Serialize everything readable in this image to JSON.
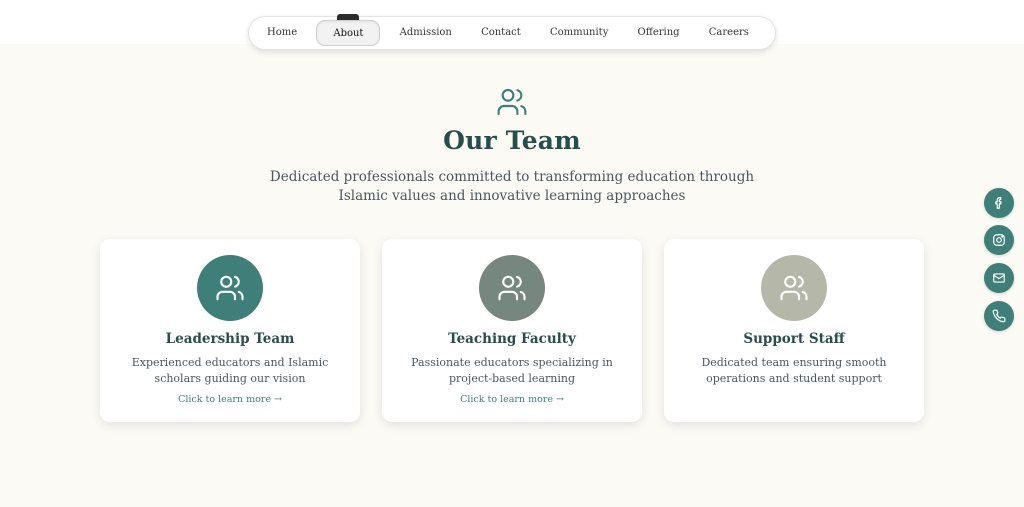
{
  "nav": {
    "items": [
      {
        "label": "Home"
      },
      {
        "label": "About",
        "active": true
      },
      {
        "label": "Admission"
      },
      {
        "label": "Contact"
      },
      {
        "label": "Community"
      },
      {
        "label": "Offering"
      },
      {
        "label": "Careers"
      }
    ]
  },
  "header": {
    "icon": "users-icon",
    "title": "Our Team",
    "subtitle": "Dedicated professionals committed to transforming education through Islamic values and innovative learning approaches"
  },
  "cards": [
    {
      "icon": "users-icon",
      "color": "#3f7f79",
      "title": "Leadership Team",
      "description": "Experienced educators and Islamic scholars guiding our vision",
      "link": "Click to learn more →"
    },
    {
      "icon": "users-icon",
      "color": "#76877f",
      "title": "Teaching Faculty",
      "description": "Passionate educators specializing in project-based learning",
      "link": "Click to learn more →"
    },
    {
      "icon": "users-icon",
      "color": "#b5b7a8",
      "title": "Support Staff",
      "description": "Dedicated team ensuring smooth operations and student support",
      "link": ""
    }
  ],
  "social": [
    {
      "icon": "facebook-icon"
    },
    {
      "icon": "instagram-icon"
    },
    {
      "icon": "mail-icon"
    },
    {
      "icon": "phone-icon"
    }
  ],
  "colors": {
    "accent": "#3f7f79",
    "heading": "#264e4b",
    "background": "#fbfaf5"
  }
}
